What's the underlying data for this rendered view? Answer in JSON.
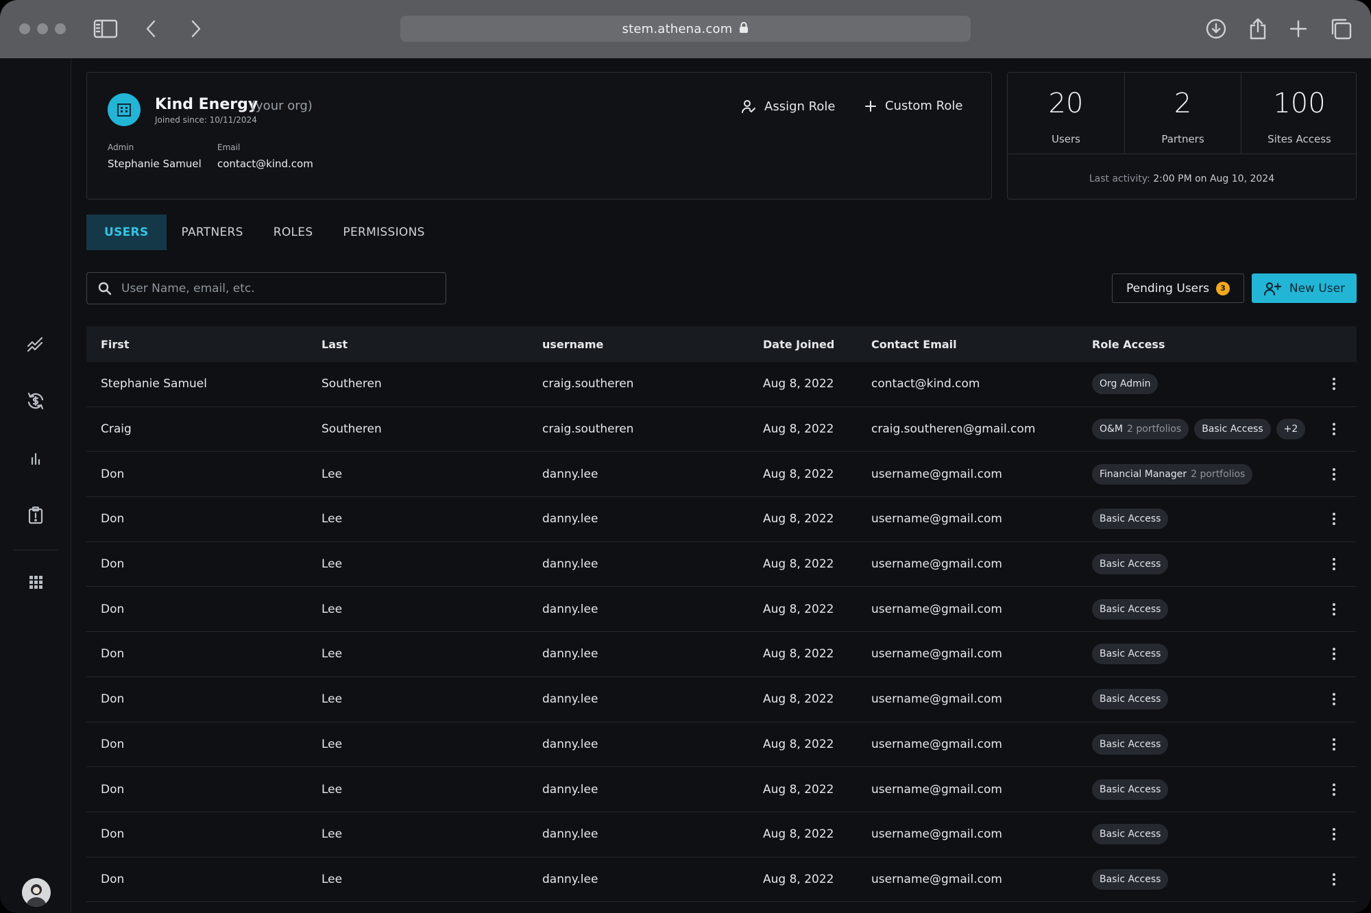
{
  "browser": {
    "url": "stem.athena.com"
  },
  "org": {
    "name": "Kind Energy",
    "tag": "(your org)",
    "joined": "Joined since: 10/11/2024",
    "admin_label": "Admin",
    "admin_value": "Stephanie Samuel",
    "email_label": "Email",
    "email_value": "contact@kind.com",
    "assign_role_label": "Assign Role",
    "custom_role_label": "Custom Role"
  },
  "stats": {
    "users_value": "20",
    "users_label": "Users",
    "partners_value": "2",
    "partners_label": "Partners",
    "sites_value": "100",
    "sites_label": "Sites Access",
    "last_activity_prefix": "Last activity:",
    "last_activity_value": "2:00 PM on Aug 10, 2024"
  },
  "tabs": [
    {
      "label": "USERS",
      "active": true
    },
    {
      "label": "PARTNERS",
      "active": false
    },
    {
      "label": "ROLES",
      "active": false
    },
    {
      "label": "PERMISSIONS",
      "active": false
    }
  ],
  "search": {
    "placeholder": "User Name, email, etc."
  },
  "toolbar": {
    "pending_label": "Pending Users",
    "pending_count": "3",
    "new_user_label": "New User"
  },
  "table": {
    "headers": [
      "First",
      "Last",
      "username",
      "Date Joined",
      "Contact Email",
      "Role Access"
    ],
    "rows": [
      {
        "first": "Stephanie Samuel",
        "last": "Southeren",
        "username": "craig.southeren",
        "date": "Aug 8, 2022",
        "email": "contact@kind.com",
        "roles": [
          {
            "name": "Org Admin",
            "sub": ""
          }
        ]
      },
      {
        "first": "Craig",
        "last": "Southeren",
        "username": "craig.southeren",
        "date": "Aug 8, 2022",
        "email": "craig.southeren@gmail.com",
        "roles": [
          {
            "name": "O&M",
            "sub": "2 portfolios"
          },
          {
            "name": "Basic Access",
            "sub": ""
          },
          {
            "name": "+2",
            "sub": ""
          }
        ]
      },
      {
        "first": "Don",
        "last": "Lee",
        "username": "danny.lee",
        "date": "Aug 8, 2022",
        "email": "username@gmail.com",
        "roles": [
          {
            "name": "Financial Manager",
            "sub": "2 portfolios"
          }
        ]
      },
      {
        "first": "Don",
        "last": "Lee",
        "username": "danny.lee",
        "date": "Aug 8, 2022",
        "email": "username@gmail.com",
        "roles": [
          {
            "name": "Basic Access",
            "sub": ""
          }
        ]
      },
      {
        "first": "Don",
        "last": "Lee",
        "username": "danny.lee",
        "date": "Aug 8, 2022",
        "email": "username@gmail.com",
        "roles": [
          {
            "name": "Basic Access",
            "sub": ""
          }
        ]
      },
      {
        "first": "Don",
        "last": "Lee",
        "username": "danny.lee",
        "date": "Aug 8, 2022",
        "email": "username@gmail.com",
        "roles": [
          {
            "name": "Basic Access",
            "sub": ""
          }
        ]
      },
      {
        "first": "Don",
        "last": "Lee",
        "username": "danny.lee",
        "date": "Aug 8, 2022",
        "email": "username@gmail.com",
        "roles": [
          {
            "name": "Basic Access",
            "sub": ""
          }
        ]
      },
      {
        "first": "Don",
        "last": "Lee",
        "username": "danny.lee",
        "date": "Aug 8, 2022",
        "email": "username@gmail.com",
        "roles": [
          {
            "name": "Basic Access",
            "sub": ""
          }
        ]
      },
      {
        "first": "Don",
        "last": "Lee",
        "username": "danny.lee",
        "date": "Aug 8, 2022",
        "email": "username@gmail.com",
        "roles": [
          {
            "name": "Basic Access",
            "sub": ""
          }
        ]
      },
      {
        "first": "Don",
        "last": "Lee",
        "username": "danny.lee",
        "date": "Aug 8, 2022",
        "email": "username@gmail.com",
        "roles": [
          {
            "name": "Basic Access",
            "sub": ""
          }
        ]
      },
      {
        "first": "Don",
        "last": "Lee",
        "username": "danny.lee",
        "date": "Aug 8, 2022",
        "email": "username@gmail.com",
        "roles": [
          {
            "name": "Basic Access",
            "sub": ""
          }
        ]
      },
      {
        "first": "Don",
        "last": "Lee",
        "username": "danny.lee",
        "date": "Aug 8, 2022",
        "email": "username@gmail.com",
        "roles": [
          {
            "name": "Basic Access",
            "sub": ""
          }
        ]
      }
    ]
  },
  "colors": {
    "accent": "#23b5d6",
    "badge": "#f3a81c",
    "background": "#0e1013"
  }
}
